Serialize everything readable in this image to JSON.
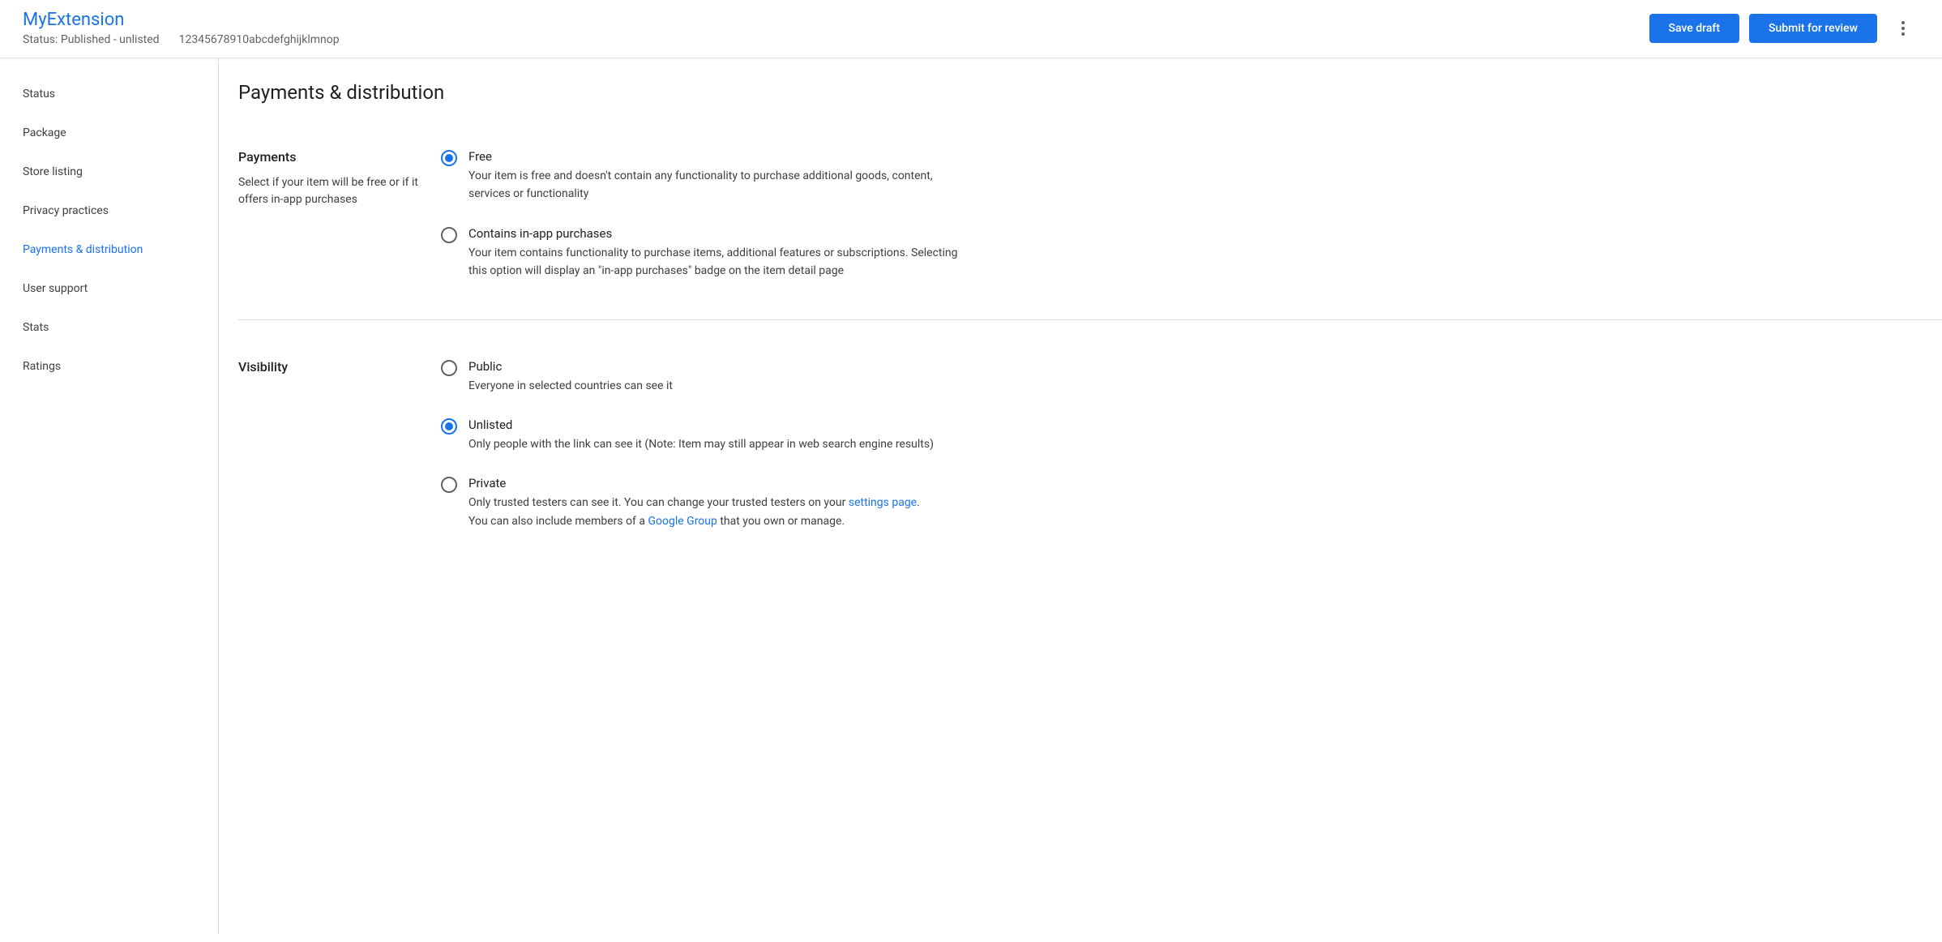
{
  "header": {
    "title": "MyExtension",
    "status": "Status: Published - unlisted",
    "id": "12345678910abcdefghijklmnop",
    "save_draft": "Save draft",
    "submit": "Submit for review"
  },
  "sidebar": {
    "items": [
      {
        "label": "Status",
        "active": false
      },
      {
        "label": "Package",
        "active": false
      },
      {
        "label": "Store listing",
        "active": false
      },
      {
        "label": "Privacy practices",
        "active": false
      },
      {
        "label": "Payments & distribution",
        "active": true
      },
      {
        "label": "User support",
        "active": false
      },
      {
        "label": "Stats",
        "active": false
      },
      {
        "label": "Ratings",
        "active": false
      }
    ]
  },
  "main": {
    "title": "Payments & distribution",
    "payments": {
      "label": "Payments",
      "desc": "Select if your item will be free or if it offers in-app purchases",
      "options": [
        {
          "title": "Free",
          "desc": "Your item is free and doesn't contain any functionality to purchase additional goods, content, services or functionality",
          "checked": true
        },
        {
          "title": "Contains in-app purchases",
          "desc": "Your item contains functionality to purchase items, additional features or subscriptions. Selecting this option will display an \"in-app purchases\" badge on the item detail page",
          "checked": false
        }
      ]
    },
    "visibility": {
      "label": "Visibility",
      "options": [
        {
          "title": "Public",
          "desc": "Everyone in selected countries can see it",
          "checked": false
        },
        {
          "title": "Unlisted",
          "desc": "Only people with the link can see it (Note: Item may still appear in web search engine results)",
          "checked": true
        },
        {
          "title": "Private",
          "desc_part1": "Only trusted testers can see it. You can change your trusted testers on your ",
          "link1": "settings page",
          "desc_part2": ".",
          "desc_part3": "You can also include members of a ",
          "link2": "Google Group",
          "desc_part4": " that you own or manage.",
          "checked": false
        }
      ]
    }
  }
}
